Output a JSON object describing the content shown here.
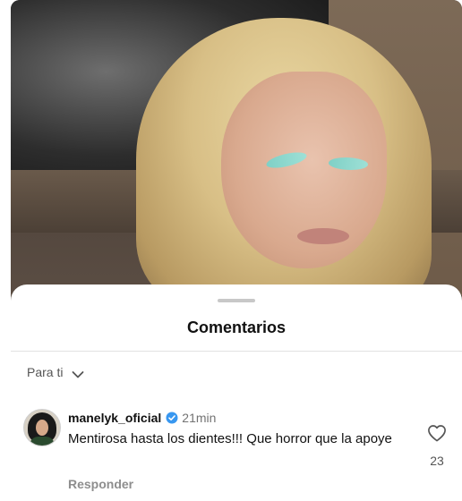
{
  "sheet": {
    "title": "Comentarios"
  },
  "sort": {
    "label": "Para ti"
  },
  "comments": [
    {
      "username": "manelyk_oficial",
      "verified": true,
      "time": "21min",
      "text": "Mentirosa hasta los dientes!!! Que horror que la apoye",
      "reply_label": "Responder",
      "likes": "23"
    }
  ],
  "icons": {
    "sort": "chevron-down-icon",
    "verified": "verified-badge-icon",
    "like": "heart-icon"
  },
  "colors": {
    "verified": "#3897f0",
    "text": "#111111",
    "muted": "#737373"
  }
}
